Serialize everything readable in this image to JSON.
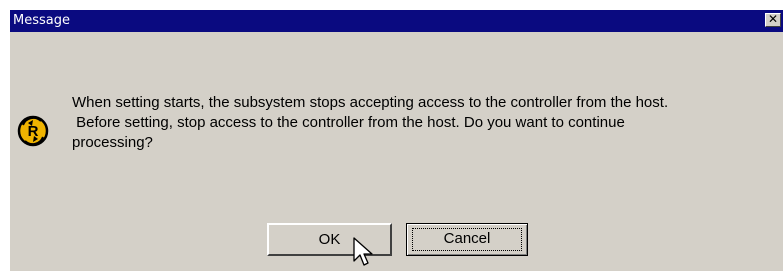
{
  "dialog": {
    "title": "Message",
    "close_glyph": "✕",
    "icon": "info-r-icon",
    "message": "When setting starts, the subsystem stops accepting access to the controller from the host.\n Before setting, stop access to the controller from the host. Do you want to continue\nprocessing?",
    "ok_label": "OK",
    "cancel_label": "Cancel"
  },
  "colors": {
    "titlebar": "#0a0a80",
    "window_bg": "#d4d0c8",
    "icon_fill": "#f0b400"
  }
}
